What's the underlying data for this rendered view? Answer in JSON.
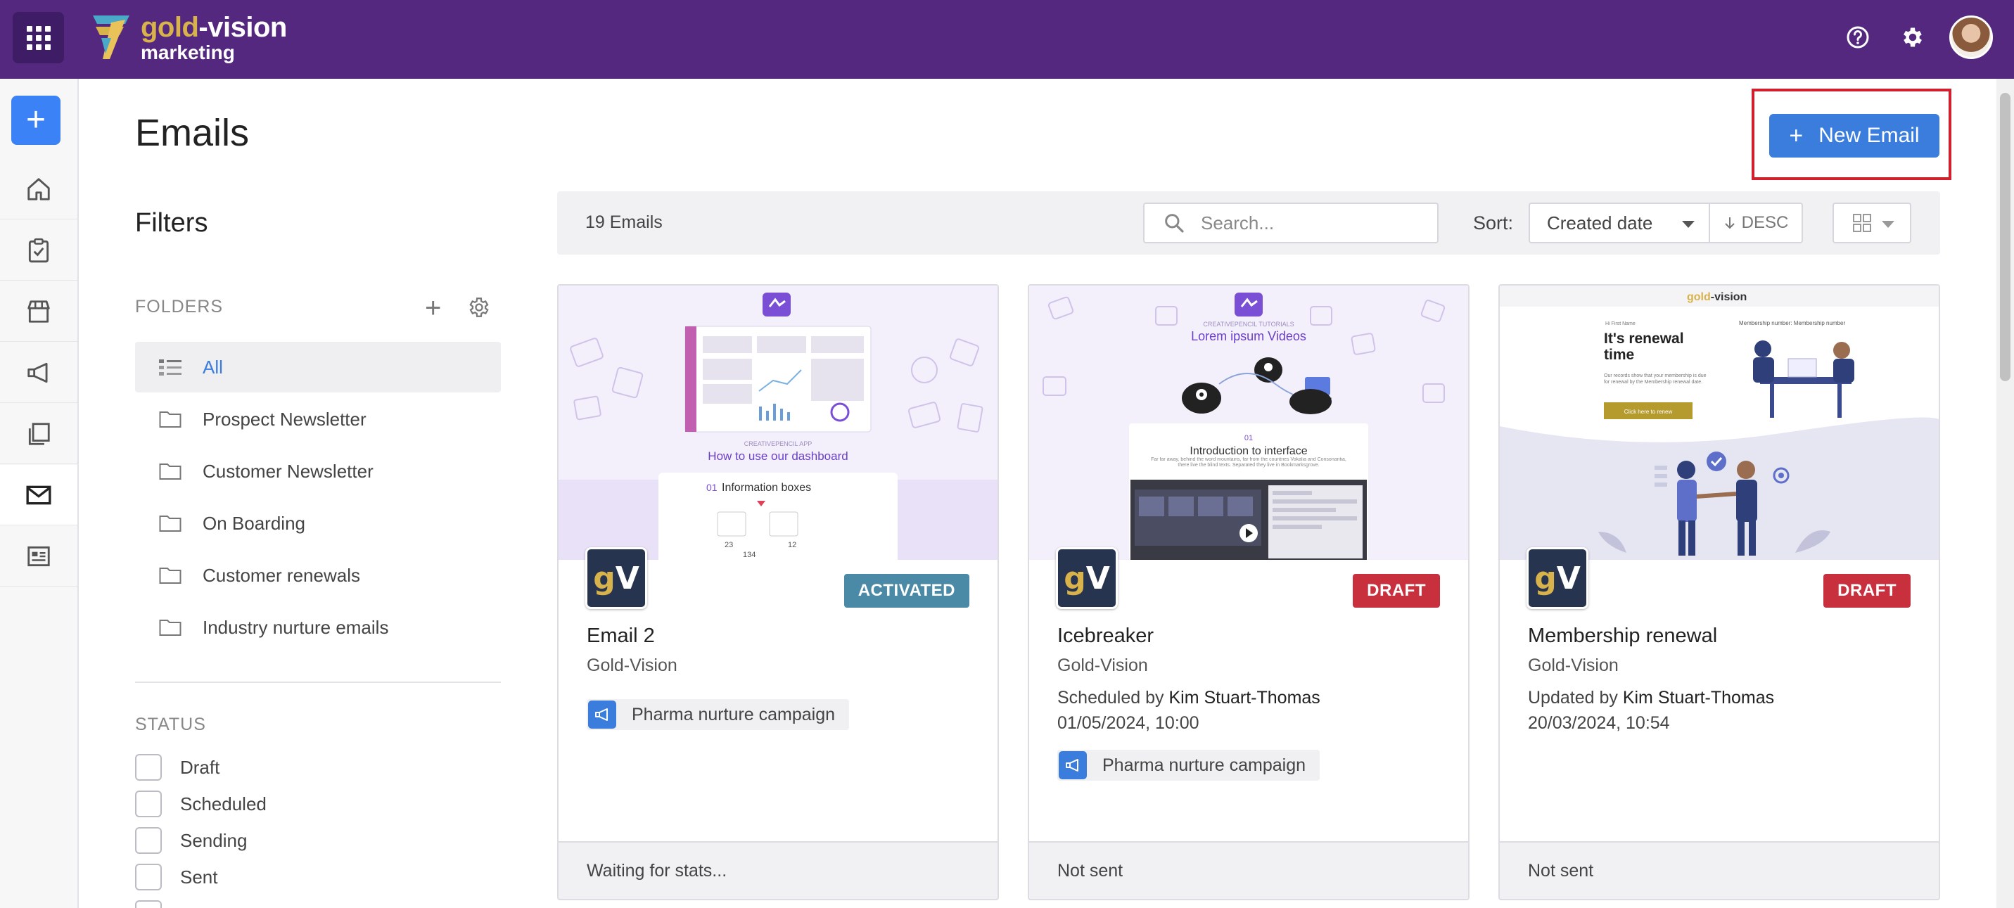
{
  "app": {
    "logo_line1_prefix": "gold",
    "logo_line1_suffix": "-vision",
    "logo_line2": "marketing",
    "brand_color": "#54287f",
    "accent_color": "#3b7ddd"
  },
  "header_icons": [
    "apps-grid-icon",
    "help-icon",
    "gear-icon",
    "user-avatar"
  ],
  "rail": {
    "add_symbol": "+",
    "items": [
      "home-icon",
      "tasks-icon",
      "store-icon",
      "campaign-icon",
      "pages-icon",
      "email-icon",
      "form-icon"
    ],
    "active": "email-icon"
  },
  "page": {
    "title": "Emails",
    "new_button_plus": "+",
    "new_button_label": "New Email"
  },
  "filters": {
    "title": "Filters",
    "folders_label": "FOLDERS",
    "folders": [
      {
        "label": "All",
        "active": true
      },
      {
        "label": "Prospect Newsletter"
      },
      {
        "label": "Customer Newsletter"
      },
      {
        "label": "On Boarding"
      },
      {
        "label": "Customer renewals"
      },
      {
        "label": "Industry nurture emails"
      }
    ],
    "status_label": "STATUS",
    "statuses": [
      "Draft",
      "Scheduled",
      "Sending",
      "Sent"
    ]
  },
  "toolbar": {
    "count": "19 Emails",
    "search_placeholder": "Search...",
    "sort_label": "Sort:",
    "sort_value": "Created date",
    "sort_direction": "DESC"
  },
  "cards": [
    {
      "name": "Email 2",
      "company": "Gold-Vision",
      "status": "ACTIVATED",
      "status_color": "#4a8aa6",
      "campaign": "Pharma nurture campaign",
      "footer": "Waiting for stats...",
      "thumb": {
        "tagline": "CREATIVEPENCIL APP",
        "headline": "How to use our dashboard",
        "section_num": "01",
        "section_title": "Information boxes",
        "stat_a": "23",
        "stat_b": "134",
        "stat_c": "12"
      }
    },
    {
      "name": "Icebreaker",
      "company": "Gold-Vision",
      "status": "DRAFT",
      "status_color": "#c9303e",
      "meta_prefix": "Scheduled by",
      "meta_person": "Kim Stuart-Thomas",
      "meta_date": "01/05/2024, 10:00",
      "campaign": "Pharma nurture campaign",
      "footer": "Not sent",
      "thumb": {
        "tagline": "CREATIVEPENCIL TUTORIALS",
        "headline": "Lorem ipsum Videos",
        "section_num": "01",
        "section_title": "Introduction to interface",
        "body": "Far far away, behind the word mountains, far from the countries Vokalia and Consonantia, there live the blind texts. Separated they live in Bookmarksgrove."
      }
    },
    {
      "name": "Membership renewal",
      "company": "Gold-Vision",
      "status": "DRAFT",
      "status_color": "#c9303e",
      "meta_prefix": "Updated by",
      "meta_person": "Kim Stuart-Thomas",
      "meta_date": "20/03/2024, 10:54",
      "footer": "Not sent",
      "thumb": {
        "brand_prefix": "gold",
        "brand_suffix": "-vision",
        "greeting": "Hi First Name",
        "member_line": "Membership number: Membership number",
        "headline": "It's renewal time",
        "body": "Our records show that your membership is due for renewal by the Membership renewal date.",
        "cta": "Click here to renew"
      }
    }
  ]
}
